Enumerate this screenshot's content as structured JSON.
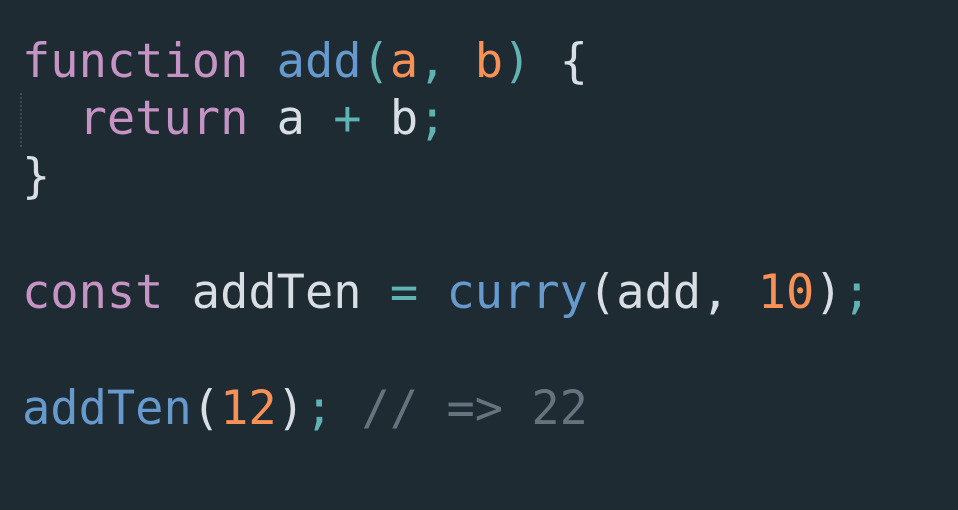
{
  "colors": {
    "background": "#1e2b33",
    "keyword": "#c594c5",
    "function": "#6699cc",
    "param": "#f99157",
    "number": "#f99157",
    "operator": "#5fb3b3",
    "plain": "#d8dee4",
    "comment": "#65737e"
  },
  "code": {
    "lines": [
      {
        "tokens": [
          {
            "text": "function",
            "kind": "keyword"
          },
          {
            "text": " ",
            "kind": "plain"
          },
          {
            "text": "add",
            "kind": "function"
          },
          {
            "text": "(",
            "kind": "operator"
          },
          {
            "text": "a",
            "kind": "param"
          },
          {
            "text": ", ",
            "kind": "operator"
          },
          {
            "text": "b",
            "kind": "param"
          },
          {
            "text": ")",
            "kind": "operator"
          },
          {
            "text": " {",
            "kind": "plain"
          }
        ]
      },
      {
        "tokens": [
          {
            "text": "  ",
            "kind": "plain"
          },
          {
            "text": "return",
            "kind": "keyword"
          },
          {
            "text": " a ",
            "kind": "plain"
          },
          {
            "text": "+",
            "kind": "operator"
          },
          {
            "text": " b",
            "kind": "plain"
          },
          {
            "text": ";",
            "kind": "operator"
          }
        ]
      },
      {
        "tokens": [
          {
            "text": "}",
            "kind": "plain"
          }
        ]
      },
      {
        "tokens": []
      },
      {
        "tokens": [
          {
            "text": "const",
            "kind": "keyword"
          },
          {
            "text": " addTen ",
            "kind": "plain"
          },
          {
            "text": "=",
            "kind": "operator"
          },
          {
            "text": " ",
            "kind": "plain"
          },
          {
            "text": "curry",
            "kind": "function"
          },
          {
            "text": "(add, ",
            "kind": "plain"
          },
          {
            "text": "10",
            "kind": "number"
          },
          {
            "text": ")",
            "kind": "plain"
          },
          {
            "text": ";",
            "kind": "operator"
          }
        ]
      },
      {
        "tokens": []
      },
      {
        "tokens": [
          {
            "text": "addTen",
            "kind": "function"
          },
          {
            "text": "(",
            "kind": "plain"
          },
          {
            "text": "12",
            "kind": "number"
          },
          {
            "text": ")",
            "kind": "plain"
          },
          {
            "text": ";",
            "kind": "operator"
          },
          {
            "text": " // => 22",
            "kind": "comment"
          }
        ]
      }
    ]
  }
}
